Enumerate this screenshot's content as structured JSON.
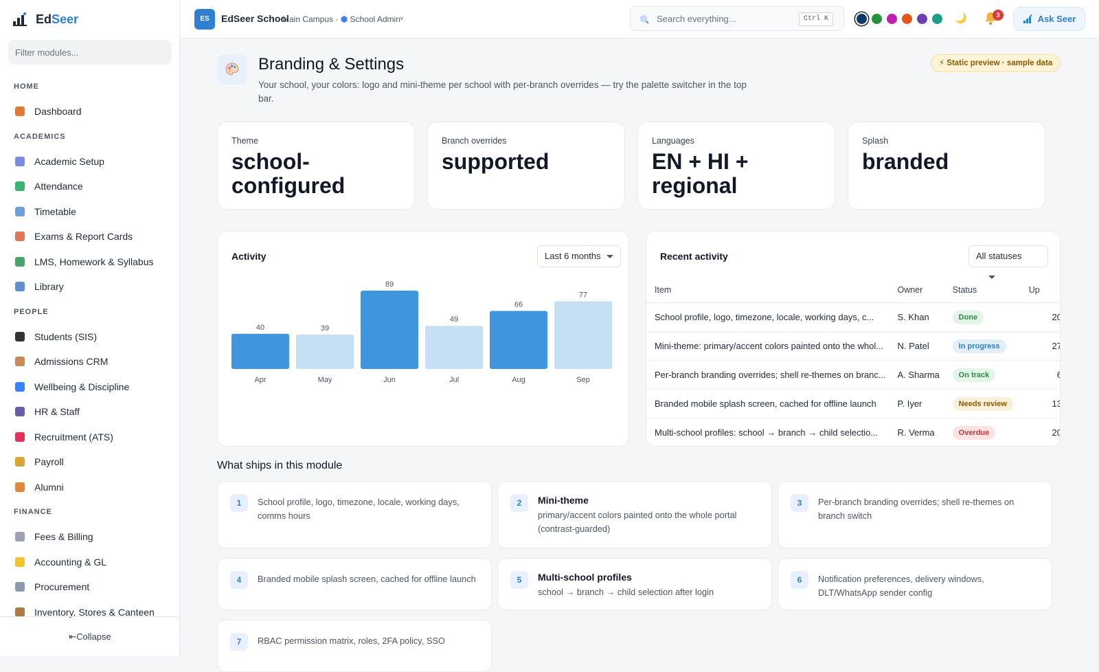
{
  "brand": {
    "name_a": "Ed",
    "name_b": "Seer"
  },
  "sidebar": {
    "filter_placeholder": "Filter modules...",
    "sections": [
      {
        "title": "HOME",
        "items": [
          {
            "label": "Dashboard",
            "icon": "house-icon",
            "color": "#e07a3a"
          }
        ]
      },
      {
        "title": "ACADEMICS",
        "items": [
          {
            "label": "Academic Setup",
            "icon": "grid-calendar-icon",
            "color": "#7b8cde"
          },
          {
            "label": "Attendance",
            "icon": "check-box-icon",
            "color": "#3cb371"
          },
          {
            "label": "Timetable",
            "icon": "calendar-icon",
            "color": "#6f9fd8"
          },
          {
            "label": "Exams & Report Cards",
            "icon": "memo-icon",
            "color": "#d97a5b"
          },
          {
            "label": "LMS, Homework & Syllabus",
            "icon": "books-icon",
            "color": "#4aa36b"
          },
          {
            "label": "Library",
            "icon": "open-book-icon",
            "color": "#5f8fcf"
          }
        ]
      },
      {
        "title": "PEOPLE",
        "items": [
          {
            "label": "Students (SIS)",
            "icon": "graduation-cap-icon",
            "color": "#333333"
          },
          {
            "label": "Admissions CRM",
            "icon": "clipboard-icon",
            "color": "#c98a5a"
          },
          {
            "label": "Wellbeing & Discipline",
            "icon": "heart-icon",
            "color": "#3b82f6"
          },
          {
            "label": "HR & Staff",
            "icon": "people-icon",
            "color": "#6b5ea8"
          },
          {
            "label": "Recruitment (ATS)",
            "icon": "magnet-icon",
            "color": "#e2335a"
          },
          {
            "label": "Payroll",
            "icon": "money-bag-icon",
            "color": "#d9a336"
          },
          {
            "label": "Alumni",
            "icon": "medal-icon",
            "color": "#e0893a"
          }
        ]
      },
      {
        "title": "FINANCE",
        "items": [
          {
            "label": "Fees & Billing",
            "icon": "receipt-icon",
            "color": "#9aa3b0"
          },
          {
            "label": "Accounting & GL",
            "icon": "ledger-icon",
            "color": "#f2c230"
          },
          {
            "label": "Procurement",
            "icon": "cart-icon",
            "color": "#8a9bb0"
          },
          {
            "label": "Inventory, Stores & Canteen",
            "icon": "package-icon",
            "color": "#b07a46"
          }
        ]
      }
    ],
    "collapse_label": "⇤Collapse"
  },
  "topbar": {
    "logo": "ES",
    "school": "EdSeer School",
    "campus": "Main Campus ·",
    "role": "School Admin",
    "role_caret": "ᵛ",
    "search_placeholder": "Search everything...",
    "shortcut": "Ctrl K",
    "palette": [
      "#0d3b66",
      "#22933b",
      "#c21cb0",
      "#e0571b",
      "#6c3fb5",
      "#1e9e8a"
    ],
    "notifications": "3",
    "ask_label": "Ask Seer"
  },
  "header": {
    "title": "Branding & Settings",
    "subtitle": "Your school, your colors: logo and mini-theme per school with per-branch overrides — try the palette switcher in the top bar.",
    "badge": "⚡ Static preview · sample data"
  },
  "stats": [
    {
      "label": "Theme",
      "value": "school-configured"
    },
    {
      "label": "Branch overrides",
      "value": "supported"
    },
    {
      "label": "Languages",
      "value": "EN + HI + regional"
    },
    {
      "label": "Splash",
      "value": "branded"
    }
  ],
  "activity": {
    "title": "Activity",
    "range": "Last 6 months"
  },
  "chart_data": {
    "type": "bar",
    "categories": [
      "Apr",
      "May",
      "Jun",
      "Jul",
      "Aug",
      "Sep"
    ],
    "values": [
      40,
      39,
      89,
      49,
      66,
      77
    ],
    "colors": [
      "#3f96df",
      "#c5dff5",
      "#3f96df",
      "#c5dff5",
      "#3f96df",
      "#c5dff5"
    ],
    "title": "Activity",
    "ylim": [
      0,
      89
    ]
  },
  "recent": {
    "title": "Recent activity",
    "filter": "All statuses",
    "columns": [
      "Item",
      "Owner",
      "Status",
      "Up"
    ],
    "rows": [
      {
        "item": "School profile, logo, timezone, locale, working days, c...",
        "owner": "S. Khan",
        "status": "Done",
        "up": "20",
        "bg": "#e3f5e6",
        "fg": "#2f8a44"
      },
      {
        "item": "Mini-theme: primary/accent colors painted onto the whol...",
        "owner": "N. Patel",
        "status": "In progress",
        "up": "27",
        "bg": "#e2effb",
        "fg": "#2f7fd2"
      },
      {
        "item": "Per-branch branding overrides; shell re-themes on branc...",
        "owner": "A. Sharma",
        "status": "On track",
        "up": "6",
        "bg": "#e3f5e6",
        "fg": "#2f8a44"
      },
      {
        "item": "Branded mobile splash screen, cached for offline launch",
        "owner": "P. Iyer",
        "status": "Needs review",
        "up": "13",
        "bg": "#fbefd9",
        "fg": "#8a5a00"
      },
      {
        "item": "Multi-school profiles: school → branch → child selectio...",
        "owner": "R. Verma",
        "status": "Overdue",
        "up": "20",
        "bg": "#fbe3e3",
        "fg": "#c23b3b"
      }
    ]
  },
  "ships": {
    "title": "What ships in this module",
    "features": [
      {
        "num": "1",
        "title": "",
        "desc": "School profile, logo, timezone, locale, working days, comms hours"
      },
      {
        "num": "2",
        "title": "Mini-theme",
        "desc": "primary/accent colors painted onto the whole portal (contrast-guarded)"
      },
      {
        "num": "3",
        "title": "",
        "desc": "Per-branch branding overrides; shell re-themes on branch switch"
      },
      {
        "num": "4",
        "title": "",
        "desc": "Branded mobile splash screen, cached for offline launch"
      },
      {
        "num": "5",
        "title": "Multi-school profiles",
        "desc": "school → branch → child selection after login"
      },
      {
        "num": "6",
        "title": "",
        "desc": "Notification preferences, delivery windows, DLT/WhatsApp sender config"
      },
      {
        "num": "7",
        "title": "",
        "desc": "RBAC permission matrix, roles, 2FA policy, SSO"
      }
    ]
  }
}
